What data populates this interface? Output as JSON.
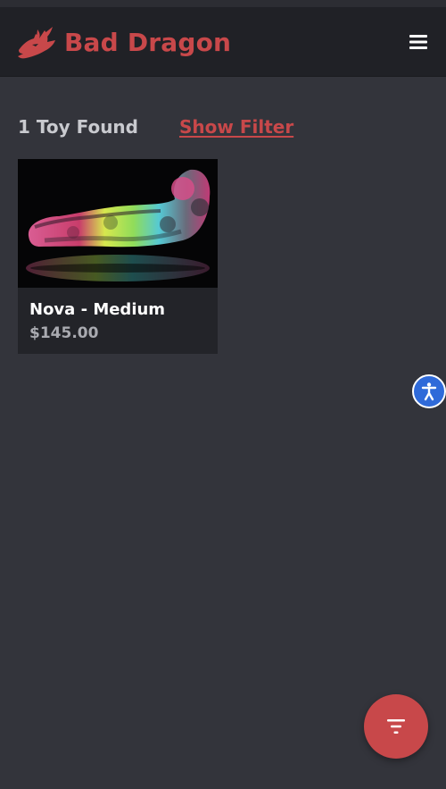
{
  "header": {
    "brand_name": "Bad Dragon",
    "logo_icon": "dragon-head-icon",
    "menu_icon": "hamburger-menu-icon"
  },
  "results": {
    "count_text": "1 Toy Found",
    "show_filter_label": "Show Filter"
  },
  "products": [
    {
      "name": "Nova - Medium",
      "price": "$145.00"
    }
  ],
  "floating": {
    "accessibility_icon": "accessibility-icon",
    "filter_icon": "filter-icon"
  },
  "colors": {
    "brand_red": "#c8484a",
    "page_background": "#33343b",
    "header_background": "#202126",
    "card_background": "#232429",
    "accessibility_blue": "#2f6ad9"
  }
}
